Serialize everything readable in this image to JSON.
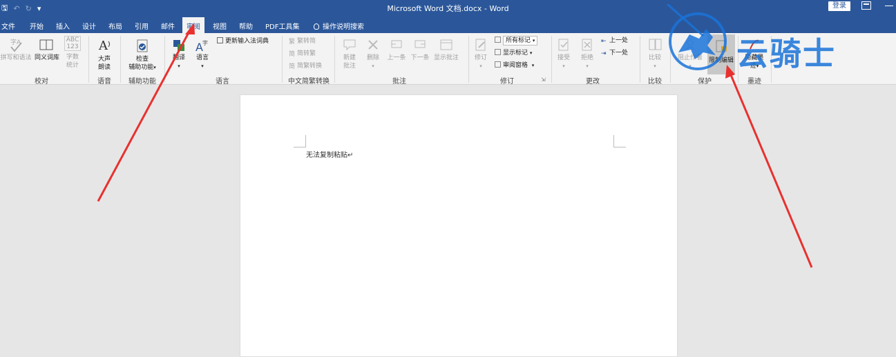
{
  "window": {
    "title": "Microsoft Word 文档.docx  -  Word",
    "login": "登录"
  },
  "tabs": [
    "文件",
    "开始",
    "插入",
    "设计",
    "布局",
    "引用",
    "邮件",
    "审阅",
    "视图",
    "帮助",
    "PDF工具集"
  ],
  "active_tab": "审阅",
  "tell_me": "操作说明搜索",
  "ribbon": {
    "proofing": {
      "spell": "拼写和语法",
      "thesaurus": "同义词库",
      "wordcount_icon": "ABC\n123",
      "wordcount1": "字数",
      "wordcount2": "统计",
      "group": "校对"
    },
    "speech": {
      "read1": "大声",
      "read2": "朗读",
      "group": "语音"
    },
    "accessibility": {
      "check1": "检查",
      "check2": "辅助功能",
      "group": "辅助功能"
    },
    "language": {
      "translate": "翻译",
      "language": "语言",
      "ime": "更新输入法词典",
      "group": "语言"
    },
    "chinese": {
      "t2s": "繁转简",
      "s2t": "简转繁",
      "convert": "简繁转换",
      "group": "中文简繁转换"
    },
    "comments": {
      "new1": "新建",
      "new2": "批注",
      "delete": "删除",
      "prev": "上一条",
      "next": "下一条",
      "show": "显示批注",
      "group": "批注"
    },
    "tracking": {
      "track": "修订",
      "markup_select": "所有标记",
      "show_markup": "显示标记",
      "pane": "审阅窗格",
      "group": "修订"
    },
    "changes": {
      "accept": "接受",
      "reject": "拒绝",
      "prev": "上一处",
      "next": "下一处",
      "group": "更改"
    },
    "compare": {
      "compare": "比较",
      "group": "比较"
    },
    "protect": {
      "block": "阻止作者",
      "restrict": "限制编辑",
      "group": "保护"
    },
    "ink": {
      "hide1": "隐藏墨",
      "hide2": "迹",
      "group": "墨迹"
    }
  },
  "document": {
    "text": "无法复制粘贴↵"
  },
  "watermark": {
    "text": "云骑士"
  },
  "colors": {
    "accent": "#2b579a",
    "arrow": "#e8312f",
    "watermark": "#1a73d9"
  }
}
